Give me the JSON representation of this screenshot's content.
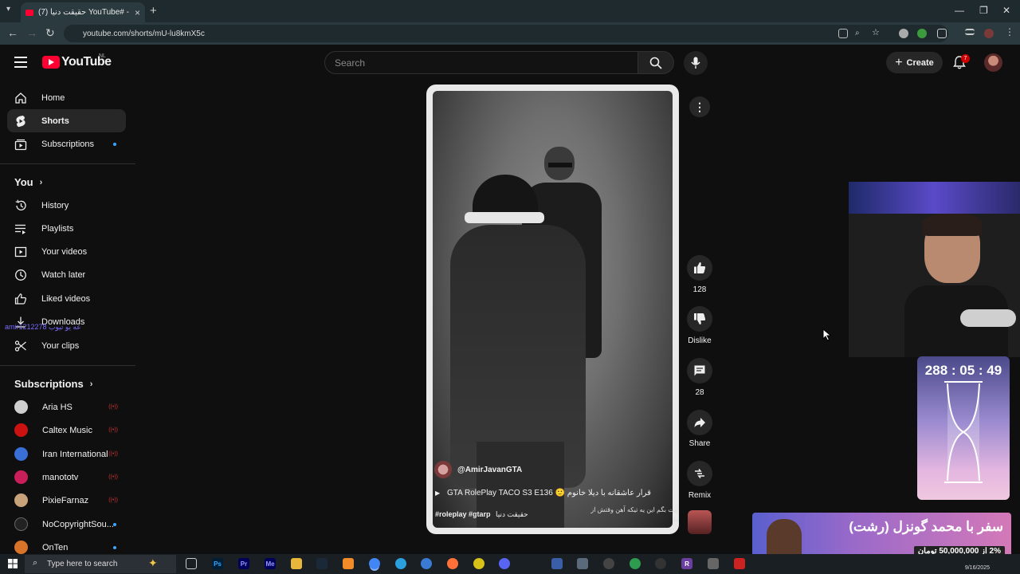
{
  "browser": {
    "tab_title": "(7) حقیقت دنیا YouTube# - ...",
    "url": "youtube.com/shorts/mU-lu8kmX5c",
    "new_tab": "+",
    "win_min": "—",
    "win_max": "❐",
    "win_close": "✕"
  },
  "header": {
    "logo_text": "YouTube",
    "country_code": "NL",
    "search_placeholder": "Search",
    "create_label": "Create",
    "notification_count": "7"
  },
  "sidebar": {
    "items": [
      {
        "label": "Home",
        "icon": "home-icon"
      },
      {
        "label": "Shorts",
        "icon": "shorts-icon"
      },
      {
        "label": "Subscriptions",
        "icon": "subscriptions-icon"
      }
    ],
    "you_heading": "You",
    "you_items": [
      {
        "label": "History",
        "icon": "history-icon"
      },
      {
        "label": "Playlists",
        "icon": "playlists-icon"
      },
      {
        "label": "Your videos",
        "icon": "your-videos-icon"
      },
      {
        "label": "Watch later",
        "icon": "watch-later-icon"
      },
      {
        "label": "Liked videos",
        "icon": "like-icon"
      },
      {
        "label": "Downloads",
        "icon": "download-icon"
      },
      {
        "label": "Your clips",
        "icon": "scissors-icon"
      }
    ],
    "subs_heading": "Subscriptions",
    "channels": [
      {
        "name": "Aria HS",
        "color": "#cfcfcf",
        "status": "live"
      },
      {
        "name": "Caltex Music",
        "color": "#cc1111",
        "status": "live"
      },
      {
        "name": "Iran International",
        "color": "#3a6fd8",
        "status": "live"
      },
      {
        "name": "manototv",
        "color": "#c81e5a",
        "status": "live"
      },
      {
        "name": "PixieFarnaz",
        "color": "#c8a27a",
        "status": "live"
      },
      {
        "name": "NoCopyrightSou...",
        "color": "#222222",
        "status": "dot"
      },
      {
        "name": "OnTen",
        "color": "#d8732a",
        "status": "dot"
      }
    ],
    "overlay_text": "amir1212278 عه یو تیوب"
  },
  "short": {
    "channel": "@AmirJavanGTA",
    "title": "GTA RolePlay TACO S3 E136 🙂 قرار عاشقانه با دیلا خانوم",
    "description": "بهت بگم این یه تیکه آهن وقتش از ما",
    "tags": "#roleplay #gtarp",
    "tags_fa": "حقیقت دنیا",
    "likes": "128",
    "dislike_label": "Dislike",
    "comments": "28",
    "share_label": "Share",
    "remix_label": "Remix"
  },
  "stream_overlay": {
    "timer": "288 : 05 : 49",
    "banner_title": "سفر با محمد گونزل (رشت)",
    "banner_sub": "2% از 50,000,000 تومان"
  },
  "taskbar": {
    "search_placeholder": "Type here to search",
    "date": "9/16/2025",
    "apps": [
      {
        "label": "Ps",
        "color": "#001e36",
        "fg": "#31a8ff"
      },
      {
        "label": "Pr",
        "color": "#00005b",
        "fg": "#9999ff"
      },
      {
        "label": "Me",
        "color": "#00005b",
        "fg": "#9999ff"
      },
      {
        "label": "R",
        "color": "#6a3fa0",
        "fg": "#ffffff"
      }
    ]
  }
}
